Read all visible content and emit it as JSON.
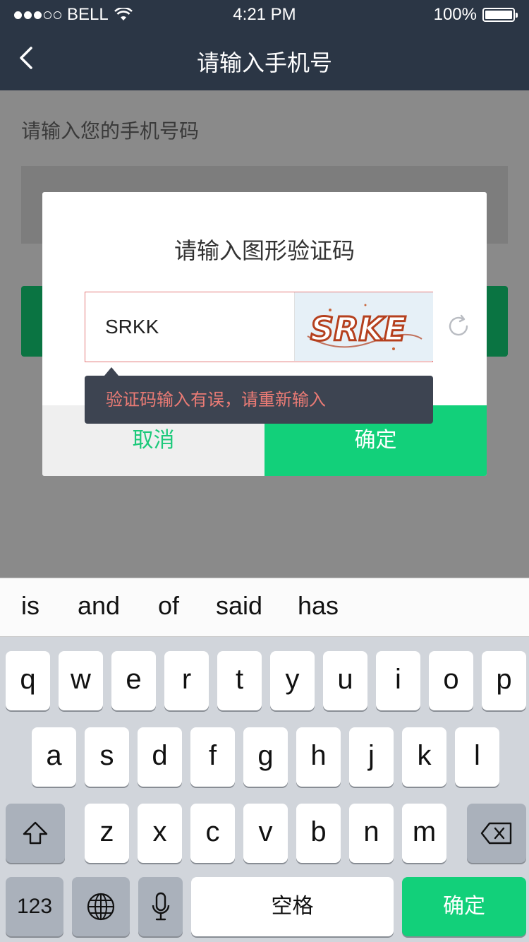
{
  "status": {
    "carrier": "BELL",
    "time": "4:21 PM",
    "battery": "100%"
  },
  "nav": {
    "title": "请输入手机号"
  },
  "page": {
    "label": "请输入您的手机号码"
  },
  "dialog": {
    "title": "请输入图形验证码",
    "input_value": "SRKK",
    "error": "验证码输入有误，请重新输入",
    "cancel": "取消",
    "confirm": "确定"
  },
  "suggestions": [
    "is",
    "and",
    "of",
    "said",
    "has"
  ],
  "keyboard": {
    "row1": [
      "q",
      "w",
      "e",
      "r",
      "t",
      "y",
      "u",
      "i",
      "o",
      "p"
    ],
    "row2": [
      "a",
      "s",
      "d",
      "f",
      "g",
      "h",
      "j",
      "k",
      "l"
    ],
    "row3": [
      "z",
      "x",
      "c",
      "v",
      "b",
      "n",
      "m"
    ],
    "numbers": "123",
    "space": "空格",
    "enter": "确定"
  },
  "colors": {
    "nav": "#2b3645",
    "accent": "#12d07a",
    "error": "#ea7b75"
  },
  "icons": [
    "back-chevron-icon",
    "wifi-icon",
    "refresh-icon",
    "shift-icon",
    "delete-icon",
    "globe-icon",
    "microphone-icon"
  ]
}
